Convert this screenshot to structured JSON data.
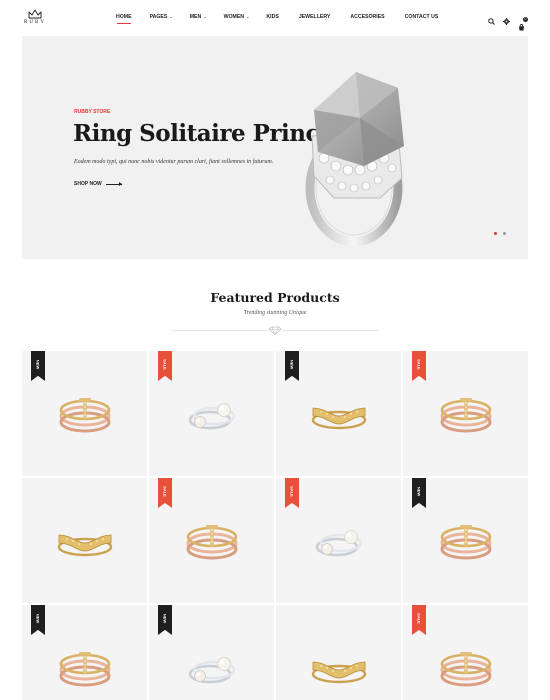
{
  "brand": {
    "name": "RUBY",
    "logo_icon": "crown-icon"
  },
  "nav": {
    "items": [
      {
        "label": "HOME",
        "active": true,
        "dropdown": false
      },
      {
        "label": "PAGES",
        "active": false,
        "dropdown": true
      },
      {
        "label": "MEN",
        "active": false,
        "dropdown": true
      },
      {
        "label": "WOMEN",
        "active": false,
        "dropdown": true
      },
      {
        "label": "KIDS",
        "active": false,
        "dropdown": false
      },
      {
        "label": "JEWELLERY",
        "active": false,
        "dropdown": false
      },
      {
        "label": "ACCESORIES",
        "active": false,
        "dropdown": false
      },
      {
        "label": "CONTACT US",
        "active": false,
        "dropdown": false
      }
    ],
    "caret_glyph": "⌄"
  },
  "header_icons": {
    "search": "search-icon",
    "settings": "gear-icon",
    "cart": "cart-icon",
    "cart_count": "0"
  },
  "hero": {
    "kicker": "RUBBY STORE",
    "title": "Ring Solitaire Princess",
    "description": "Eodem modo typi, qui nunc nobis videntur parum clari, fiant sollemnes in futurum.",
    "cta": "SHOP NOW",
    "slides": 2,
    "active_slide": 1
  },
  "featured": {
    "title": "Featured Products",
    "subtitle": "Trending stunning Unique",
    "divider_icon": "diamond-icon"
  },
  "products": [
    {
      "badge": "NEW",
      "ring": "rose-cross"
    },
    {
      "badge": "SALE",
      "ring": "pearl"
    },
    {
      "badge": "NEW",
      "ring": "gold-bow"
    },
    {
      "badge": "SALE",
      "ring": "rose-cross"
    },
    {
      "badge": "",
      "ring": "gold-bow"
    },
    {
      "badge": "SALE",
      "ring": "rose-cross"
    },
    {
      "badge": "SALE",
      "ring": "pearl"
    },
    {
      "badge": "NEW",
      "ring": "rose-cross"
    },
    {
      "badge": "NEW",
      "ring": "rose-cross"
    },
    {
      "badge": "NEW",
      "ring": "pearl"
    },
    {
      "badge": "",
      "ring": "gold-bow"
    },
    {
      "badge": "SALE",
      "ring": "rose-cross"
    }
  ],
  "colors": {
    "accent": "#e53935",
    "new_badge": "#1f1f1f",
    "sale_badge": "#e8503a",
    "hero_bg": "#f1f1f1",
    "card_bg": "#f4f4f5"
  }
}
